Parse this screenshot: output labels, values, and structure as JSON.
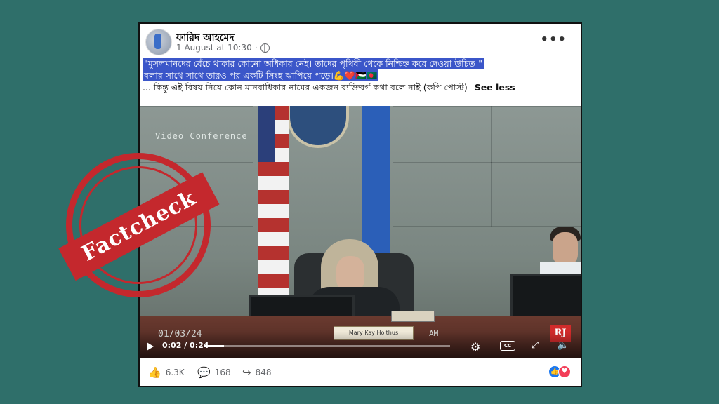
{
  "post": {
    "author": "ফারিদ আহমেদ",
    "timestamp": "1 August at 10:30",
    "more_icon": "more-options-icon",
    "text_line1": "\"মুসলমানদের বেঁচে থাকার কোনো অধিকার নেই। তাদের পৃথিবী থেকে নিশ্চিহ্ন করে দেওয়া উচিত।\"",
    "text_line2": "বলার সাথে সাথে তারও পর একটি সিংহ ঝাপিয়ে পড়ে।💪❤️🇵🇸🇧🇩",
    "text_line3": "... কিন্তু এই বিষয় নিয়ে কোন মানবাধিকার নামের একজন ব্যক্তিবর্গ কথা বলে নাই (কপি পোস্ট)",
    "see_less": "See less"
  },
  "video": {
    "overlay_label": "Video Conference",
    "date_stamp": "01/03/24",
    "am_stamp": "AM",
    "nameplate": "Mary Kay Holthus",
    "current_time": "0:02 / 0:24",
    "progress_fraction": 0.08,
    "watermark": "RJ",
    "cc_label": "CC"
  },
  "reactions": {
    "likes": "6.3K",
    "comments": "168",
    "shares": "848"
  },
  "stamp": {
    "text": "Factcheck",
    "color": "#c4282d"
  },
  "colors": {
    "background": "#2f6f6a",
    "highlight": "#3b56c9"
  }
}
